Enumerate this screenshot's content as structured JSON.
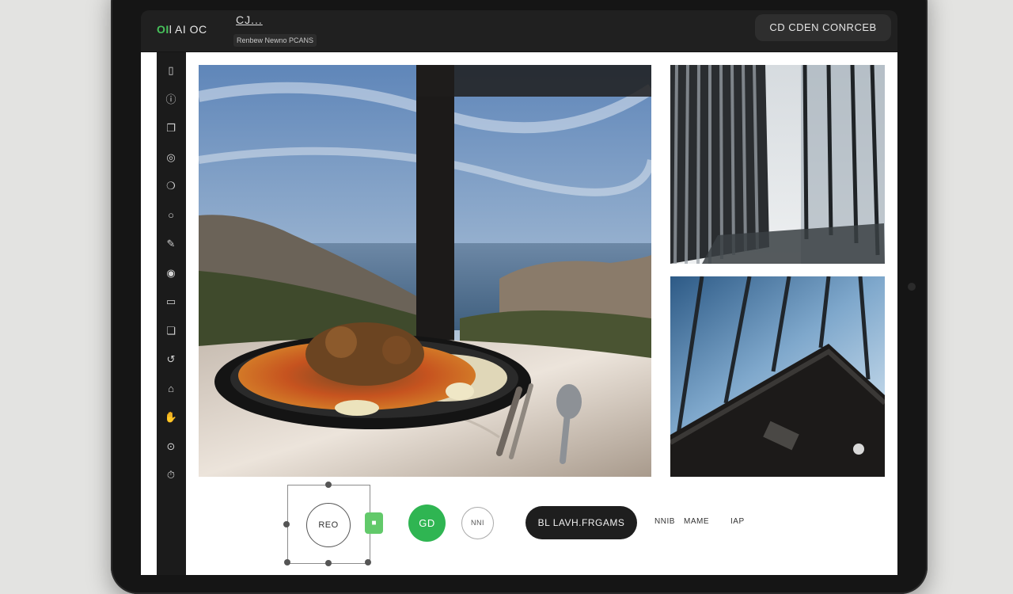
{
  "header": {
    "brand_accent": "OI",
    "brand_rest": "l AI OC",
    "title": "CJ...",
    "subtitle": "Renbew Newno   PCANS",
    "action": "CD CDEN CONRCEB"
  },
  "toolbar": {
    "tools": [
      {
        "icon": "square-icon",
        "glyph": "▯"
      },
      {
        "icon": "info-icon",
        "glyph": "ⓘ"
      },
      {
        "icon": "copy-icon",
        "glyph": "❐"
      },
      {
        "icon": "target-icon",
        "glyph": "◎"
      },
      {
        "icon": "badge-icon",
        "glyph": "❍"
      },
      {
        "icon": "circle-icon",
        "glyph": "○"
      },
      {
        "icon": "pen-icon",
        "glyph": "✎"
      },
      {
        "icon": "lens-icon",
        "glyph": "◉"
      },
      {
        "icon": "crop-icon",
        "glyph": "▭"
      },
      {
        "icon": "layers-icon",
        "glyph": "❏"
      },
      {
        "icon": "loop-icon",
        "glyph": "↺"
      },
      {
        "icon": "bell-icon",
        "glyph": "⌂"
      },
      {
        "icon": "hand-icon",
        "glyph": "✋"
      },
      {
        "icon": "link-icon",
        "glyph": "⊙"
      },
      {
        "icon": "clock-icon",
        "glyph": "⏱"
      }
    ]
  },
  "controls": {
    "record_label": "REO",
    "tag_label": "■",
    "go_label": "GD",
    "small_label": "NNI",
    "pill_label": "BL LAVH.FRGAMS",
    "link_1": "NNIB",
    "link_2": "MAME",
    "link_3": "IAP"
  },
  "colors": {
    "accent_green": "#2fb552",
    "device_frame": "#151515",
    "canvas": "#ffffff"
  }
}
